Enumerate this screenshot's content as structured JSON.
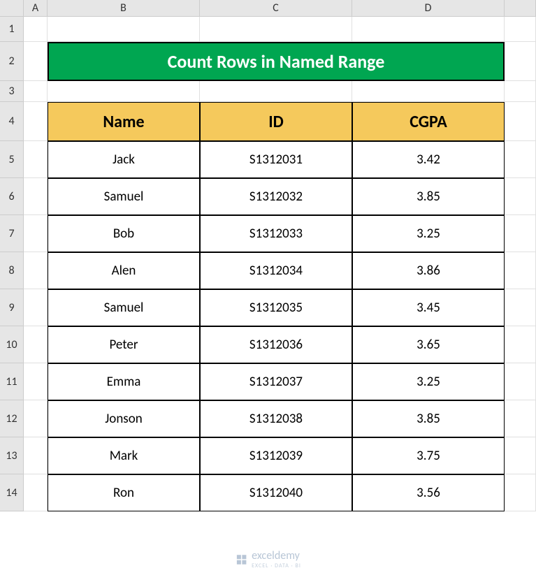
{
  "columns": [
    "A",
    "B",
    "C",
    "D"
  ],
  "row_labels": [
    "1",
    "2",
    "3",
    "4",
    "5",
    "6",
    "7",
    "8",
    "9",
    "10",
    "11",
    "12",
    "13",
    "14"
  ],
  "title": "Count Rows in Named Range",
  "headers": {
    "name": "Name",
    "id": "ID",
    "cgpa": "CGPA"
  },
  "rows": [
    {
      "name": "Jack",
      "id": "S1312031",
      "cgpa": "3.42"
    },
    {
      "name": "Samuel",
      "id": "S1312032",
      "cgpa": "3.85"
    },
    {
      "name": "Bob",
      "id": "S1312033",
      "cgpa": "3.25"
    },
    {
      "name": "Alen",
      "id": "S1312034",
      "cgpa": "3.86"
    },
    {
      "name": "Samuel",
      "id": "S1312035",
      "cgpa": "3.45"
    },
    {
      "name": "Peter",
      "id": "S1312036",
      "cgpa": "3.65"
    },
    {
      "name": "Emma",
      "id": "S1312037",
      "cgpa": "3.25"
    },
    {
      "name": "Jonson",
      "id": "S1312038",
      "cgpa": "3.85"
    },
    {
      "name": "Mark",
      "id": "S1312039",
      "cgpa": "3.75"
    },
    {
      "name": "Ron",
      "id": "S1312040",
      "cgpa": "3.56"
    }
  ],
  "watermark": {
    "label": "exceldemy",
    "sub": "EXCEL · DATA · BI"
  },
  "chart_data": {
    "type": "table",
    "title": "Count Rows in Named Range",
    "columns": [
      "Name",
      "ID",
      "CGPA"
    ],
    "data": [
      [
        "Jack",
        "S1312031",
        3.42
      ],
      [
        "Samuel",
        "S1312032",
        3.85
      ],
      [
        "Bob",
        "S1312033",
        3.25
      ],
      [
        "Alen",
        "S1312034",
        3.86
      ],
      [
        "Samuel",
        "S1312035",
        3.45
      ],
      [
        "Peter",
        "S1312036",
        3.65
      ],
      [
        "Emma",
        "S1312037",
        3.25
      ],
      [
        "Jonson",
        "S1312038",
        3.85
      ],
      [
        "Mark",
        "S1312039",
        3.75
      ],
      [
        "Ron",
        "S1312040",
        3.56
      ]
    ]
  }
}
